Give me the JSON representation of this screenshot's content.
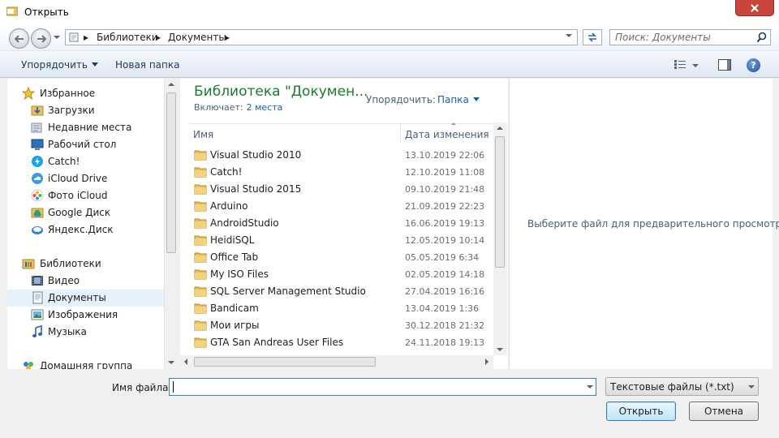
{
  "window": {
    "title": "Открыть"
  },
  "address": {
    "crumbs": [
      "Библиотеки",
      "Документы"
    ],
    "search_placeholder": "Поиск: Документы"
  },
  "toolbar": {
    "organize_label": "Упорядочить",
    "new_folder_label": "Новая папка"
  },
  "sidebar": {
    "favorites": {
      "label": "Избранное",
      "items": [
        {
          "label": "Загрузки",
          "icon": "downloads-icon"
        },
        {
          "label": "Недавние места",
          "icon": "recent-places-icon"
        },
        {
          "label": "Рабочий стол",
          "icon": "desktop-icon"
        },
        {
          "label": "Catch!",
          "icon": "catch-icon"
        },
        {
          "label": "iCloud Drive",
          "icon": "icloud-icon"
        },
        {
          "label": "Фото iCloud",
          "icon": "icloud-photos-icon"
        },
        {
          "label": "Google Диск",
          "icon": "google-drive-icon"
        },
        {
          "label": "Яндекс.Диск",
          "icon": "yandex-disk-icon"
        }
      ]
    },
    "libraries": {
      "label": "Библиотеки",
      "items": [
        {
          "label": "Видео",
          "icon": "video-icon"
        },
        {
          "label": "Документы",
          "icon": "documents-icon",
          "selected": true
        },
        {
          "label": "Изображения",
          "icon": "images-icon"
        },
        {
          "label": "Музыка",
          "icon": "music-icon"
        }
      ]
    },
    "homegroup": {
      "label": "Домашняя группа"
    }
  },
  "main": {
    "library_title": "Библиотека \"Докумен...",
    "includes_label": "Включает:",
    "includes_link": "2 места",
    "arrange_label": "Упорядочить:",
    "arrange_value": "Папка",
    "columns": {
      "name": "Имя",
      "date": "Дата изменения"
    },
    "files": [
      {
        "name": "Visual Studio 2010",
        "date": "13.10.2019 22:06"
      },
      {
        "name": "Catch!",
        "date": "12.10.2019 11:08"
      },
      {
        "name": "Visual Studio 2015",
        "date": "09.10.2019 21:48"
      },
      {
        "name": "Arduino",
        "date": "21.09.2019 22:23"
      },
      {
        "name": "AndroidStudio",
        "date": "16.06.2019 19:13"
      },
      {
        "name": "HeidiSQL",
        "date": "12.05.2019 10:14"
      },
      {
        "name": "Office Tab",
        "date": "05.05.2019 6:34"
      },
      {
        "name": "My ISO Files",
        "date": "02.05.2019 14:18"
      },
      {
        "name": "SQL Server Management Studio",
        "date": "27.04.2019 16:16"
      },
      {
        "name": "Bandicam",
        "date": "13.04.2019 1:36"
      },
      {
        "name": "Мои игры",
        "date": "30.12.2018 21:32"
      },
      {
        "name": "GTA San Andreas User Files",
        "date": "24.11.2018 19:13"
      }
    ]
  },
  "preview": {
    "message": "Выберите файл для предварительного просмотра."
  },
  "footer": {
    "filename_label": "Имя файла:",
    "filename_value": "",
    "filter_value": "Текстовые файлы (*.txt)",
    "open_label": "Открыть",
    "cancel_label": "Отмена"
  },
  "colors": {
    "folder": "#e8c060",
    "library_title": "#1e7a2e",
    "link": "#1d5fa8",
    "close": "#c7463b"
  }
}
